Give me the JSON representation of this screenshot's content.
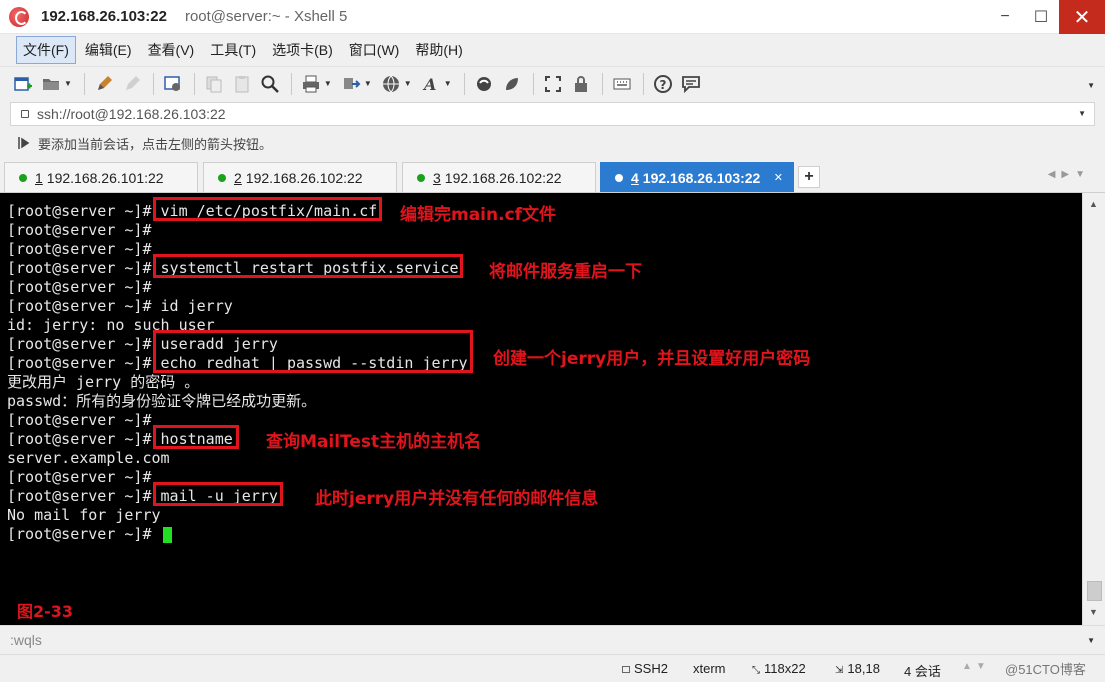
{
  "window": {
    "host": "192.168.26.103:22",
    "subtitle": "root@server:~ - Xshell 5",
    "minimize": "−",
    "maximize": "☐",
    "close": "✕"
  },
  "menu": [
    "文件(F)",
    "编辑(E)",
    "查看(V)",
    "工具(T)",
    "选项卡(B)",
    "窗口(W)",
    "帮助(H)"
  ],
  "address": "ssh://root@192.168.26.103:22",
  "hint": "要添加当前会话，点击左侧的箭头按钮。",
  "tabs": [
    {
      "num": "1",
      "label": "192.168.26.101:22",
      "active": false
    },
    {
      "num": "2",
      "label": "192.168.26.102:22",
      "active": false
    },
    {
      "num": "3",
      "label": "192.168.26.102:22",
      "active": false
    },
    {
      "num": "4",
      "label": "192.168.26.103:22",
      "active": true
    }
  ],
  "tab_add": "+",
  "tab_close": "✕",
  "terminal": {
    "lines": [
      "[root@server ~]# vim /etc/postfix/main.cf",
      "[root@server ~]#",
      "[root@server ~]#",
      "[root@server ~]# systemctl restart postfix.service",
      "[root@server ~]#",
      "[root@server ~]# id jerry",
      "id: jerry: no such user",
      "[root@server ~]# useradd jerry",
      "[root@server ~]# echo redhat | passwd --stdin jerry",
      "更改用户 jerry 的密码 。",
      "passwd：所有的身份验证令牌已经成功更新。",
      "[root@server ~]#",
      "[root@server ~]# hostname",
      "server.example.com",
      "[root@server ~]#",
      "[root@server ~]# mail -u jerry",
      "No mail for jerry",
      "[root@server ~]# "
    ],
    "annotations": [
      "编辑完main.cf文件",
      "将邮件服务重启一下",
      "创建一个jerry用户，并且设置好用户密码",
      "查询MailTest主机的主机名",
      "此时jerry用户并没有任何的邮件信息"
    ],
    "figure_label": "图2-33"
  },
  "cmdline": ":wqls",
  "status": {
    "protocol": "SSH2",
    "term": "xterm",
    "size": "118x22",
    "cursor_pos": "18,18",
    "sessions": "4 会话",
    "watermark": "@51CTO博客"
  },
  "colors": {
    "annotation": "#e0141c",
    "active_tab": "#2b7bd0",
    "cursor": "#22e022",
    "terminal_bg": "#000000"
  }
}
